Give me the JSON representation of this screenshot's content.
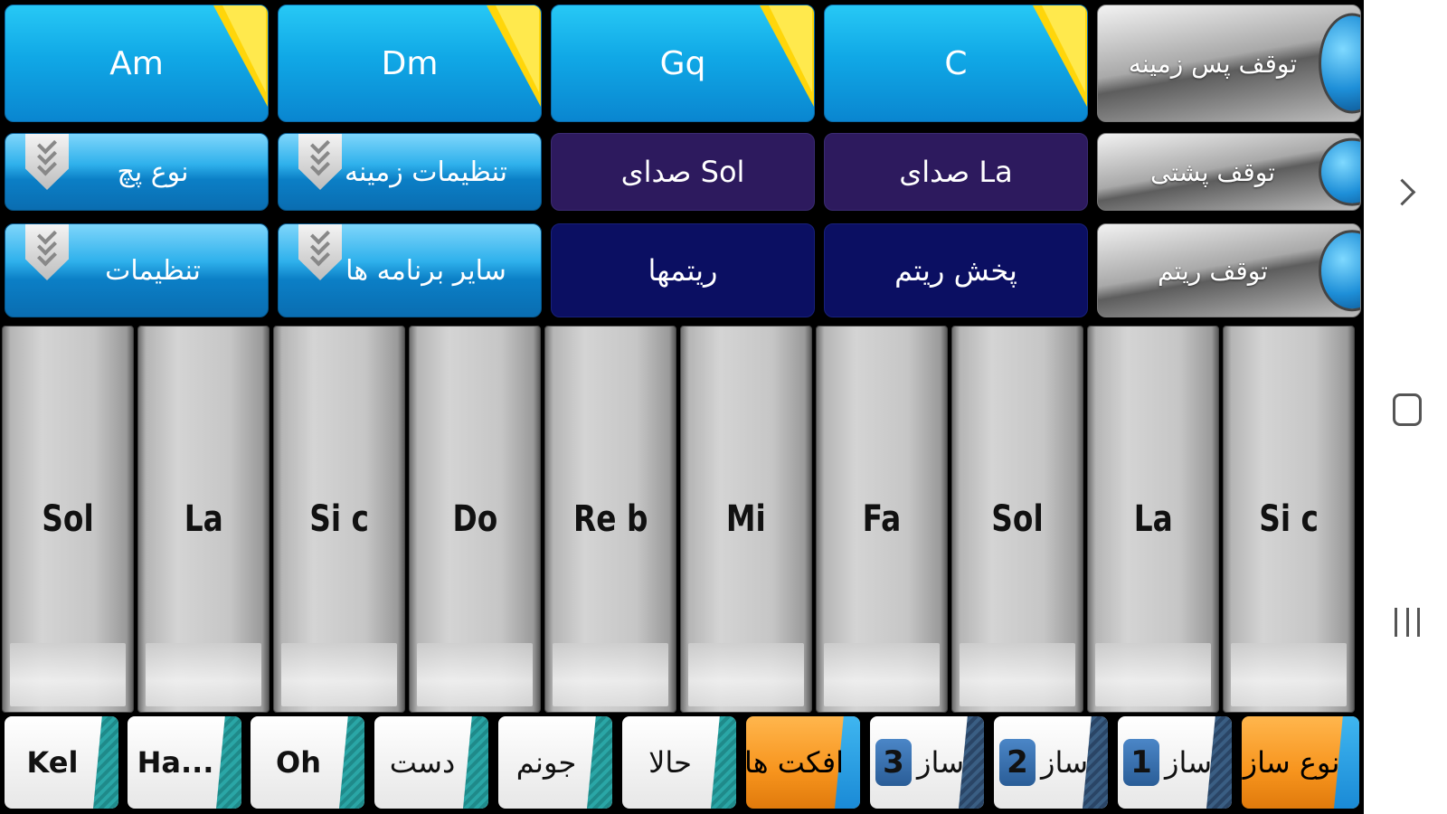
{
  "chords": [
    "Am",
    "Dm",
    "Gq",
    "C"
  ],
  "stop_background": "توقف پس زمینه",
  "row2": {
    "pitch_type": "نوع پچ",
    "background_settings": "تنظیمات زمینه",
    "sound_sol": "صدای Sol",
    "sound_la": "صدای La",
    "stop_back": "توقف پشتی"
  },
  "row3": {
    "settings": "تنظیمات",
    "other_apps": "سایر برنامه ها",
    "rhythms": "ریتمها",
    "play_rhythm": "پخش ریتم",
    "stop_rhythm": "توقف ریتم"
  },
  "keys": [
    "Sol",
    "La",
    "Si c",
    "Do",
    "Re b",
    "Mi",
    "Fa",
    "Sol",
    "La",
    "Si c"
  ],
  "bottom": {
    "kel": "Kel",
    "ha": "Ha...",
    "oh": "Oh",
    "dast": "دست",
    "jonam": "جونم",
    "hala": "حالا",
    "effects": "افکت ها",
    "saz_label": "ساز",
    "saz3": "3",
    "saz2": "2",
    "saz1": "1",
    "instrument_type": "نوع ساز"
  },
  "colors": {
    "chord_blue": "#10a8e6",
    "corner_yellow": "#ffd60a",
    "purple": "#2d1a5e",
    "navy": "#0b0f62",
    "orange": "#f7941d"
  }
}
